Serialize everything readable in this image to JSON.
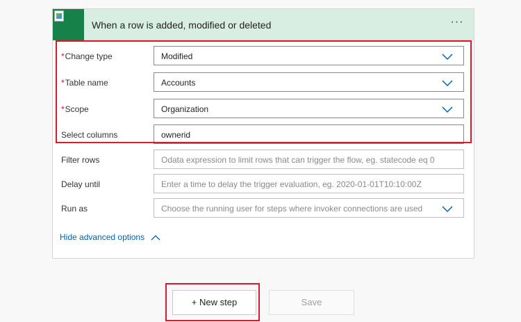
{
  "trigger": {
    "title": "When a row is added, modified or deleted",
    "more_label": "···",
    "accent_color": "#d9eee2",
    "icon_color": "#16824a"
  },
  "fields": {
    "change_type": {
      "label": "Change type",
      "required": "*",
      "value": "Modified"
    },
    "table_name": {
      "label": "Table name",
      "required": "*",
      "value": "Accounts"
    },
    "scope": {
      "label": "Scope",
      "required": "*",
      "value": "Organization"
    },
    "select_columns": {
      "label": "Select columns",
      "value": "ownerid"
    },
    "filter_rows": {
      "label": "Filter rows",
      "placeholder": "Odata expression to limit rows that can trigger the flow, eg. statecode eq 0"
    },
    "delay_until": {
      "label": "Delay until",
      "placeholder": "Enter a time to delay the trigger evaluation, eg. 2020-01-01T10:10:00Z"
    },
    "run_as": {
      "label": "Run as",
      "placeholder": "Choose the running user for steps where invoker connections are used"
    }
  },
  "advanced_toggle": {
    "label": "Hide advanced options"
  },
  "actions": {
    "new_step": "+ New step",
    "save": "Save"
  },
  "colors": {
    "highlight": "#e0162b",
    "link": "#0063b1",
    "required": "#e81123"
  },
  "icons": {
    "connector": "broken-image-icon",
    "dropdown": "chevron-down-icon",
    "collapse": "chevron-up-icon"
  }
}
